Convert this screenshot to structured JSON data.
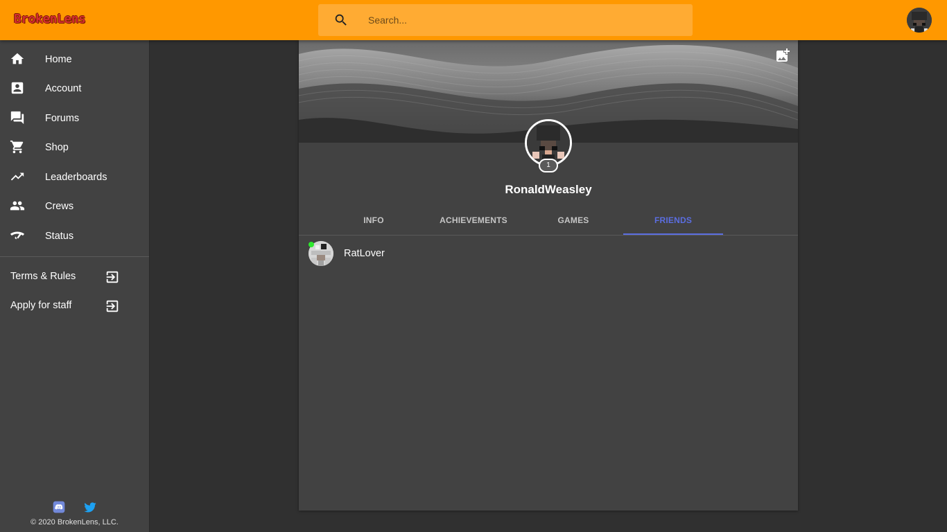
{
  "app": {
    "logo_text": "BrokenLens",
    "accent_color": "#ff9800"
  },
  "search": {
    "placeholder": "Search..."
  },
  "sidebar": {
    "nav": [
      {
        "label": "Home",
        "icon": "home-icon"
      },
      {
        "label": "Account",
        "icon": "account-box-icon"
      },
      {
        "label": "Forums",
        "icon": "forum-icon"
      },
      {
        "label": "Shop",
        "icon": "cart-icon"
      },
      {
        "label": "Leaderboards",
        "icon": "trending-up-icon"
      },
      {
        "label": "Crews",
        "icon": "people-icon"
      },
      {
        "label": "Status",
        "icon": "wifi-signal-icon"
      }
    ],
    "external": [
      {
        "label": "Terms & Rules",
        "icon": "exit-to-app-icon"
      },
      {
        "label": "Apply for staff",
        "icon": "exit-to-app-icon"
      }
    ],
    "social": [
      {
        "icon": "discord-icon",
        "color": "#7289da"
      },
      {
        "icon": "twitter-icon",
        "color": "#1da1f2"
      }
    ],
    "copyright": "© 2020 BrokenLens, LLC."
  },
  "profile": {
    "username": "RonaldWeasley",
    "level": "1",
    "tabs": [
      "INFO",
      "ACHIEVEMENTS",
      "GAMES",
      "FRIENDS"
    ],
    "active_tab": "FRIENDS",
    "active_tab_color": "#5b6ee1"
  },
  "friends": [
    {
      "name": "RatLover",
      "online": true,
      "status_color": "#2ee82e"
    }
  ]
}
